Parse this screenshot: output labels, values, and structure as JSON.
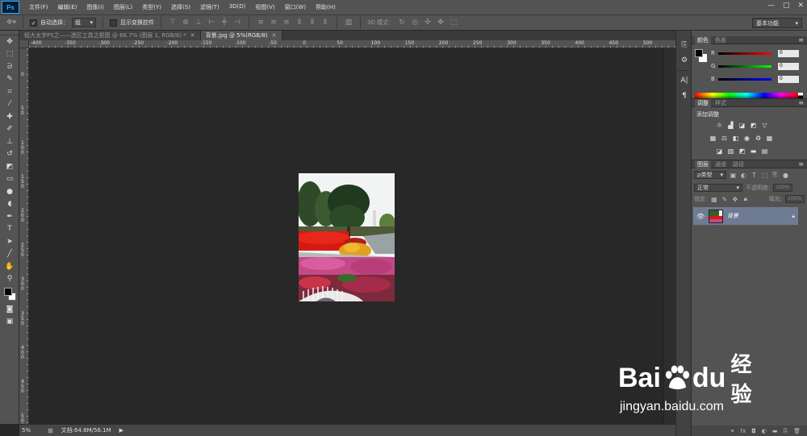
{
  "app": {
    "logo": "Ps",
    "menu": [
      "文件(F)",
      "编辑(E)",
      "图像(I)",
      "图层(L)",
      "类型(Y)",
      "选择(S)",
      "滤镜(T)",
      "3D(D)",
      "视图(V)",
      "窗口(W)",
      "帮助(H)"
    ],
    "window_controls": [
      "—",
      "□",
      "✕"
    ]
  },
  "options_bar": {
    "auto_select_label": "自动选择：",
    "auto_select_value": "组",
    "show_transform_label": "显示变换控件",
    "mode_3d_label": "3D 模式：",
    "workspace": "基本功能"
  },
  "tools": [
    {
      "name": "move-tool",
      "glyph": "✥"
    },
    {
      "name": "marquee-tool",
      "glyph": "⬚"
    },
    {
      "name": "lasso-tool",
      "glyph": "ᘐ"
    },
    {
      "name": "quick-select-tool",
      "glyph": "✎"
    },
    {
      "name": "crop-tool",
      "glyph": "⌗"
    },
    {
      "name": "eyedropper-tool",
      "glyph": "⁄"
    },
    {
      "name": "healing-brush-tool",
      "glyph": "✚"
    },
    {
      "name": "brush-tool",
      "glyph": "✐"
    },
    {
      "name": "clone-stamp-tool",
      "glyph": "⊥"
    },
    {
      "name": "history-brush-tool",
      "glyph": "↺"
    },
    {
      "name": "eraser-tool",
      "glyph": "◩"
    },
    {
      "name": "gradient-tool",
      "glyph": "▭"
    },
    {
      "name": "blur-tool",
      "glyph": "●"
    },
    {
      "name": "dodge-tool",
      "glyph": "◖"
    },
    {
      "name": "pen-tool",
      "glyph": "✒"
    },
    {
      "name": "type-tool",
      "glyph": "T"
    },
    {
      "name": "path-select-tool",
      "glyph": "➤"
    },
    {
      "name": "line-tool",
      "glyph": "╱"
    },
    {
      "name": "hand-tool",
      "glyph": "✋"
    },
    {
      "name": "zoom-tool",
      "glyph": "⚲"
    }
  ],
  "extra_tools": [
    {
      "name": "quick-mask-icon",
      "glyph": "◙"
    },
    {
      "name": "screen-mode-icon",
      "glyph": "▣"
    }
  ],
  "tabs": [
    {
      "label": "程大太字PS之——选区工具之抠图 @ 66.7% (图层 1, RGB/8) *",
      "active": false
    },
    {
      "label": "背景.jpg @ 5%(RGB/8)",
      "active": true
    }
  ],
  "ruler_top_labels": [
    "-400",
    "-350",
    "-300",
    "-250",
    "-200",
    "-150",
    "-100",
    "-50",
    "0",
    "50",
    "100",
    "150",
    "200",
    "250",
    "300",
    "350",
    "400",
    "450",
    "500"
  ],
  "ruler_left_labels": [
    "0",
    "50",
    "100",
    "150",
    "200",
    "250",
    "300",
    "350",
    "400",
    "450",
    "500"
  ],
  "status": {
    "zoom": "5%",
    "doc": "文档:64.6M/56.1M"
  },
  "color_panel": {
    "tabs": [
      "颜色",
      "色板"
    ],
    "rows": [
      {
        "letter": "R",
        "value": "0"
      },
      {
        "letter": "G",
        "value": "0"
      },
      {
        "letter": "B",
        "value": "0"
      }
    ]
  },
  "adjust_panel": {
    "tabs": [
      "调整",
      "样式"
    ],
    "title": "添加调整"
  },
  "layers_panel": {
    "tabs": [
      "图层",
      "通道",
      "路径"
    ],
    "kind": "ρ类型",
    "blend_mode": "正常",
    "opacity_label": "不透明度:",
    "opacity_value": "100%",
    "lock_label": "锁定:",
    "fill_label": "填充:",
    "fill_value": "100%",
    "layer_name": "背景"
  },
  "watermark": {
    "brand_a": "Bai",
    "brand_b": "du",
    "brand_cn": "经验",
    "url": "jingyan.baidu.com"
  },
  "colors": {
    "accent": "#31a8ff",
    "layer_selected": "#6f7b92"
  }
}
